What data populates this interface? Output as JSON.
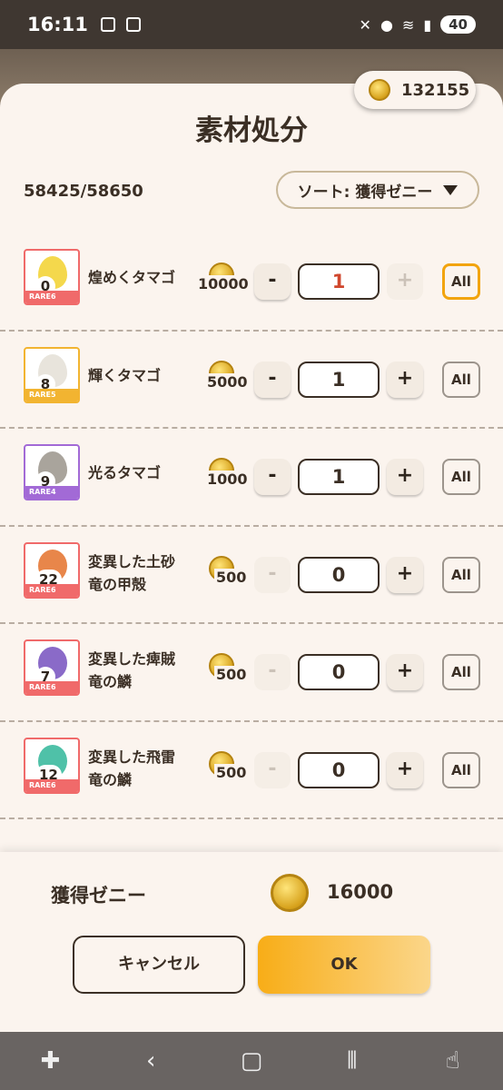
{
  "status": {
    "time": "16:11",
    "battery": "40"
  },
  "header": {
    "coins": "132155",
    "title": "素材処分",
    "capacity": "58425/58650",
    "sort_label": "ソート: 獲得ゼニー"
  },
  "items": [
    {
      "name": "煌めくタマゴ",
      "count": "0",
      "rarity": "RARE6",
      "price": "10000",
      "qty": "1",
      "rarity_color": "#f06a6a",
      "minus_enabled": true,
      "plus_enabled": false
    },
    {
      "name": "輝くタマゴ",
      "count": "8",
      "rarity": "RARE5",
      "price": "5000",
      "qty": "1",
      "rarity_color": "#f2b431",
      "minus_enabled": true,
      "plus_enabled": true
    },
    {
      "name": "光るタマゴ",
      "count": "9",
      "rarity": "RARE4",
      "price": "1000",
      "qty": "1",
      "rarity_color": "#a26ad6",
      "minus_enabled": true,
      "plus_enabled": true
    },
    {
      "name": "変異した土砂竜の甲殻",
      "count": "22",
      "rarity": "RARE6",
      "price": "500",
      "qty": "0",
      "rarity_color": "#f06a6a",
      "minus_enabled": false,
      "plus_enabled": true
    },
    {
      "name": "変異した痺賊竜の鱗",
      "count": "7",
      "rarity": "RARE6",
      "price": "500",
      "qty": "0",
      "rarity_color": "#f06a6a",
      "minus_enabled": false,
      "plus_enabled": true
    },
    {
      "name": "変異した飛雷竜の鱗",
      "count": "12",
      "rarity": "RARE6",
      "price": "500",
      "qty": "0",
      "rarity_color": "#f06a6a",
      "minus_enabled": false,
      "plus_enabled": true
    }
  ],
  "footer": {
    "earn_label": "獲得ゼニー",
    "earn_value": "16000",
    "cancel_label": "キャンセル",
    "ok_label": "OK"
  },
  "common": {
    "all_label": "All",
    "minus_label": "-",
    "plus_label": "+"
  },
  "colors": {
    "accent": "#f8ad17",
    "first_qty": "#d0472d"
  }
}
